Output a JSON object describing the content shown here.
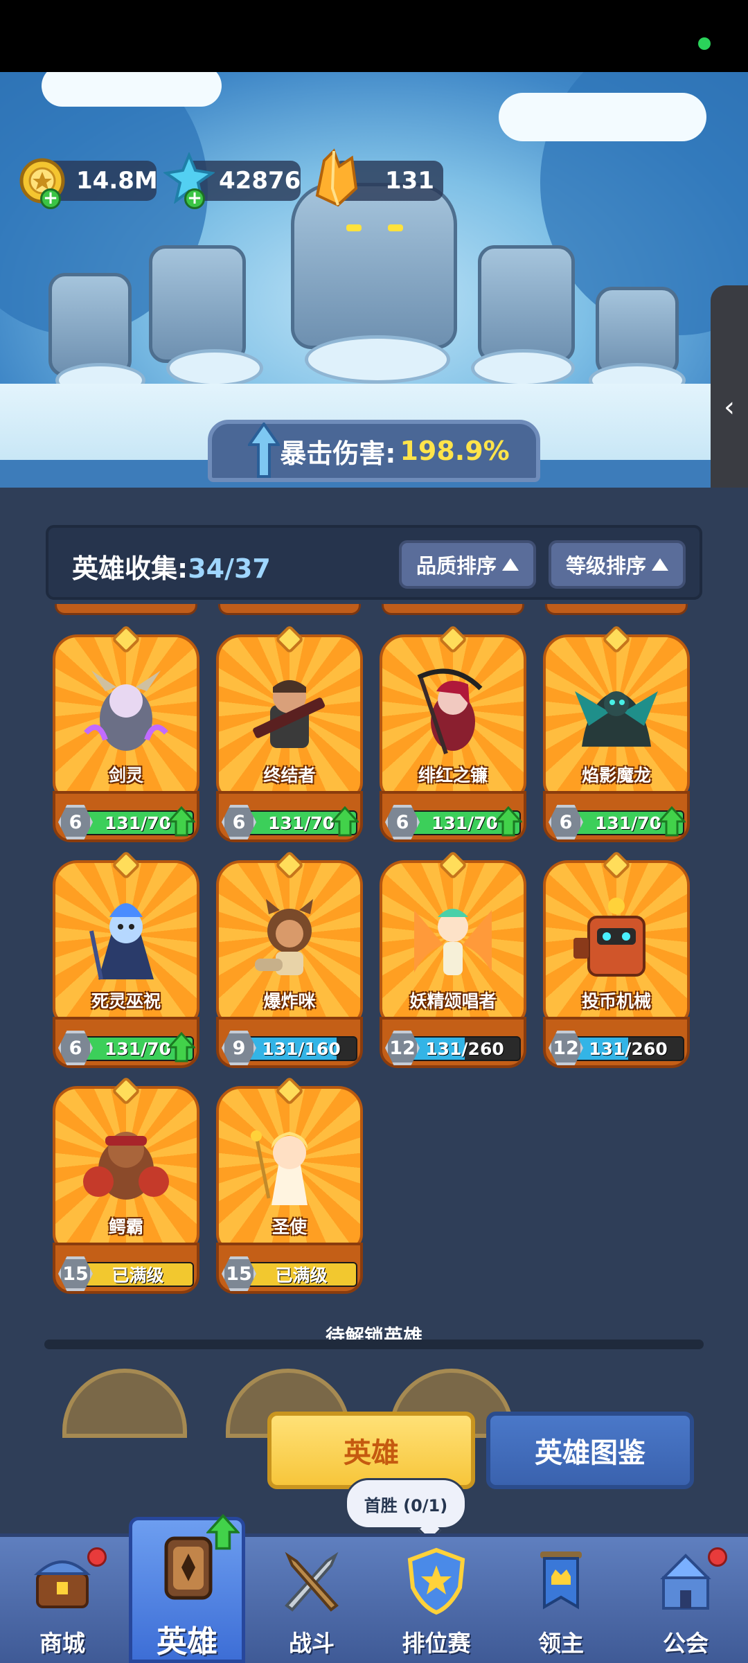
{
  "resources": {
    "gold": "14.8M",
    "gems": "42876",
    "crystals": "131"
  },
  "crit_banner": {
    "label": "暴击伤害:",
    "value": "198.9%"
  },
  "side_tab": {
    "icon": "chevron-left-icon",
    "glyph": "‹"
  },
  "collection": {
    "label": "英雄收集:",
    "count": "34/37",
    "sort_quality": "品质排序",
    "sort_level": "等级排序"
  },
  "heroes": [
    {
      "name": "剑灵",
      "level": "6",
      "progress_text": "131/70",
      "progress": 1.0,
      "bar": "green",
      "upgrade": true
    },
    {
      "name": "终结者",
      "level": "6",
      "progress_text": "131/70",
      "progress": 1.0,
      "bar": "green",
      "upgrade": true
    },
    {
      "name": "绯红之镰",
      "level": "6",
      "progress_text": "131/70",
      "progress": 1.0,
      "bar": "green",
      "upgrade": true
    },
    {
      "name": "焰影魔龙",
      "level": "6",
      "progress_text": "131/70",
      "progress": 1.0,
      "bar": "green",
      "upgrade": true
    },
    {
      "name": "死灵巫祝",
      "level": "6",
      "progress_text": "131/70",
      "progress": 1.0,
      "bar": "green",
      "upgrade": true
    },
    {
      "name": "爆炸咪",
      "level": "9",
      "progress_text": "131/160",
      "progress": 0.82,
      "bar": "blue",
      "upgrade": false
    },
    {
      "name": "妖精颂唱者",
      "level": "12",
      "progress_text": "131/260",
      "progress": 0.5,
      "bar": "blue",
      "upgrade": false
    },
    {
      "name": "投币机械",
      "level": "12",
      "progress_text": "131/260",
      "progress": 0.5,
      "bar": "blue",
      "upgrade": false
    },
    {
      "name": "鳄霸",
      "level": "15",
      "progress_text": "已满级",
      "progress": 1.0,
      "bar": "gold",
      "upgrade": false
    },
    {
      "name": "圣使",
      "level": "15",
      "progress_text": "已满级",
      "progress": 1.0,
      "bar": "gold",
      "upgrade": false
    }
  ],
  "locked_section": {
    "title": "待解锁英雄"
  },
  "tabs": {
    "hero": "英雄",
    "codex": "英雄图鉴"
  },
  "tooltip": {
    "text": "首胜 (0/1)"
  },
  "nav": {
    "items": [
      {
        "label": "商城",
        "icon": "shop-chest-icon",
        "badge": true
      },
      {
        "label": "英雄",
        "icon": "hero-card-icon",
        "badge": false,
        "active": true
      },
      {
        "label": "战斗",
        "icon": "crossed-swords-icon",
        "badge": false
      },
      {
        "label": "排位赛",
        "icon": "rank-shield-icon",
        "badge": false
      },
      {
        "label": "领主",
        "icon": "banner-crown-icon",
        "badge": false
      },
      {
        "label": "公会",
        "icon": "guild-castle-icon",
        "badge": true
      }
    ]
  },
  "colors": {
    "bar_green": "#3ccf5a",
    "bar_blue": "#33b4e6",
    "bar_gold": "#f2c82f",
    "accent_yellow": "#ffe44a"
  }
}
